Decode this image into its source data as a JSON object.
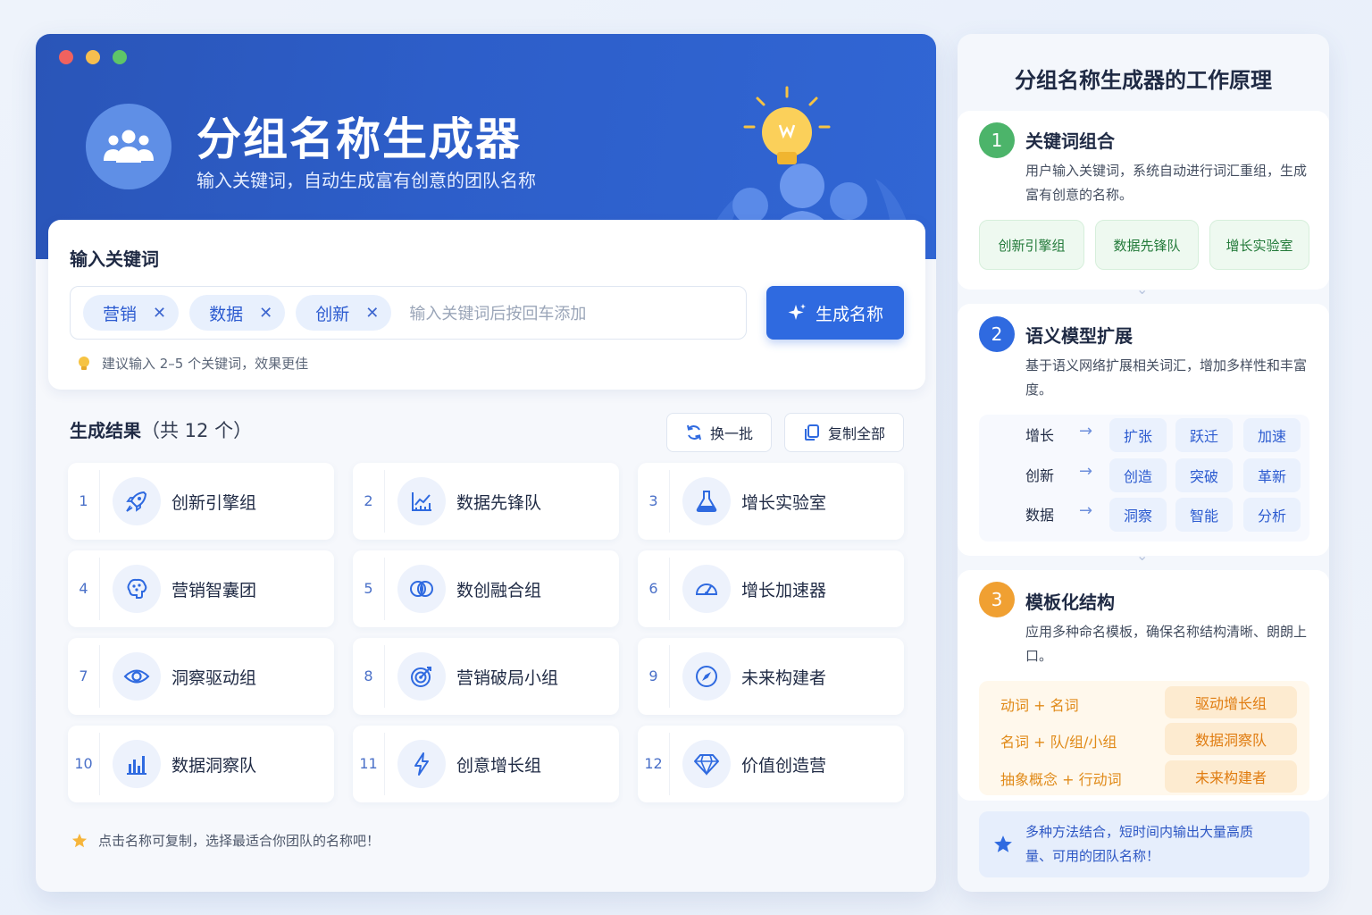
{
  "header": {
    "title": "分组名称生成器",
    "subtitle": "输入关键词，自动生成富有创意的团队名称"
  },
  "input": {
    "section_title": "输入关键词",
    "tags": [
      "营销",
      "数据",
      "创新"
    ],
    "placeholder": "输入关键词后按回车添加",
    "generate_label": "生成名称",
    "hint": "建议输入 2–5 个关键词，效果更佳"
  },
  "results": {
    "title": "生成结果",
    "count_label": "（共 12 个）",
    "refresh_label": "换一批",
    "copy_all_label": "复制全部",
    "items": [
      {
        "num": "1",
        "name": "创新引擎组",
        "icon": "rocket-icon"
      },
      {
        "num": "2",
        "name": "数据先锋队",
        "icon": "line-chart-icon"
      },
      {
        "num": "3",
        "name": "增长实验室",
        "icon": "flask-icon"
      },
      {
        "num": "4",
        "name": "营销智囊团",
        "icon": "brain-icon"
      },
      {
        "num": "5",
        "name": "数创融合组",
        "icon": "overlap-circles-icon"
      },
      {
        "num": "6",
        "name": "增长加速器",
        "icon": "speedometer-icon"
      },
      {
        "num": "7",
        "name": "洞察驱动组",
        "icon": "eye-icon"
      },
      {
        "num": "8",
        "name": "营销破局小组",
        "icon": "target-icon"
      },
      {
        "num": "9",
        "name": "未来构建者",
        "icon": "compass-icon"
      },
      {
        "num": "10",
        "name": "数据洞察队",
        "icon": "bar-chart-icon"
      },
      {
        "num": "11",
        "name": "创意增长组",
        "icon": "lightning-icon"
      },
      {
        "num": "12",
        "name": "价值创造营",
        "icon": "diamond-icon"
      }
    ],
    "footer_hint": "点击名称可复制，选择最适合你团队的名称吧！"
  },
  "panel": {
    "title": "分组名称生成器的工作原理",
    "step1": {
      "num": "1",
      "title": "关键词组合",
      "desc": "用户输入关键词，系统自动进行词汇重组，生成富有创意的名称。",
      "chips": [
        "创新引擎组",
        "数据先锋队",
        "增长实验室"
      ]
    },
    "step2": {
      "num": "2",
      "title": "语义模型扩展",
      "desc": "基于语义网络扩展相关词汇，增加多样性和丰富度。",
      "rows": [
        {
          "word": "增长",
          "arrow": "→",
          "expansions": [
            "扩张",
            "跃迁",
            "加速"
          ]
        },
        {
          "word": "创新",
          "arrow": "→",
          "expansions": [
            "创造",
            "突破",
            "革新"
          ]
        },
        {
          "word": "数据",
          "arrow": "→",
          "expansions": [
            "洞察",
            "智能",
            "分析"
          ]
        }
      ]
    },
    "step3": {
      "num": "3",
      "title": "模板化结构",
      "desc": "应用多种命名模板，确保名称结构清晰、朗朗上口。",
      "templates": [
        {
          "pattern": "动词 + 名词",
          "example": "驱动增长组"
        },
        {
          "pattern": "名词 + 队/组/小组",
          "example": "数据洞察队"
        },
        {
          "pattern": "抽象概念 + 行动词",
          "example": "未来构建者"
        }
      ]
    },
    "summary": "多种方法结合，短时间内输出大量高质量、可用的团队名称！"
  },
  "colors": {
    "hero": "#2d5ec9",
    "accent": "#2f6ae0",
    "step1": "#4cb46a",
    "step2": "#2f6ae0",
    "step3": "#f0a032"
  }
}
